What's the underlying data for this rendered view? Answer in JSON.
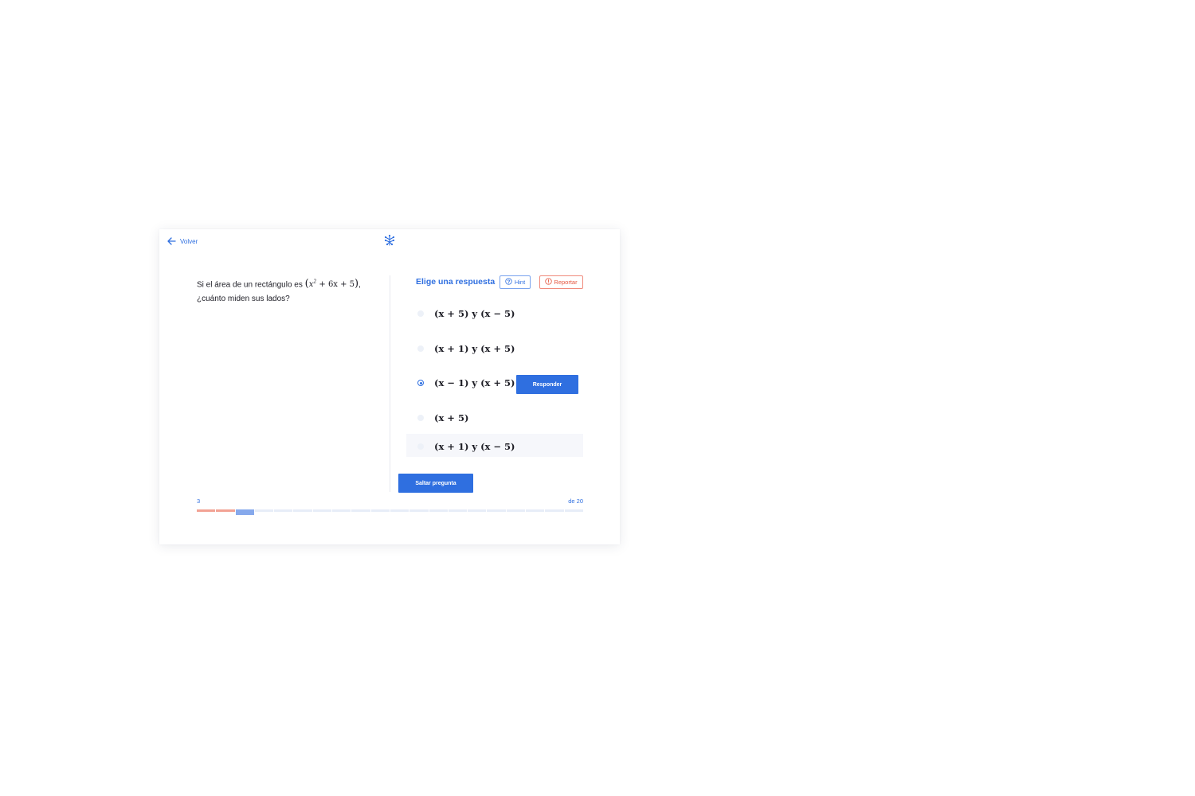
{
  "nav": {
    "back_label": "Volver"
  },
  "question": {
    "text_before": "Si el área de un rectángulo es ",
    "math_open": "(",
    "math_base": "x",
    "math_exp": "2",
    "math_rest": " + 6x + 5",
    "math_close": ")",
    "text_after": ",",
    "line2": "¿cuánto miden sus lados?"
  },
  "answers": {
    "title": "Elige una respuesta",
    "hint_label": "Hint",
    "report_label": "Reportar",
    "options": [
      {
        "label": "(x + 5) y (x − 5)",
        "selected": false
      },
      {
        "label": "(x + 1) y (x + 5)",
        "selected": false
      },
      {
        "label": "(x − 1) y (x + 5)",
        "selected": true
      },
      {
        "label": "(x + 5)",
        "selected": false
      },
      {
        "label": "(x + 1) y (x − 5)",
        "selected": false
      }
    ],
    "respond_label": "Responder"
  },
  "actions": {
    "skip_label": "Saltar pregunta"
  },
  "progress": {
    "current": "3",
    "total_label": "de 20",
    "total": 20,
    "answered_wrong": 2
  },
  "colors": {
    "accent": "#2f6fe0",
    "error": "#e5563f",
    "progress_wrong": "#f2a294",
    "progress_current": "#86a9ec",
    "progress_empty": "#e7edf8"
  },
  "icons": {
    "back": "arrow-left-icon",
    "logo": "brand-logo-icon",
    "hint": "question-circle-icon",
    "report": "alert-circle-icon"
  }
}
